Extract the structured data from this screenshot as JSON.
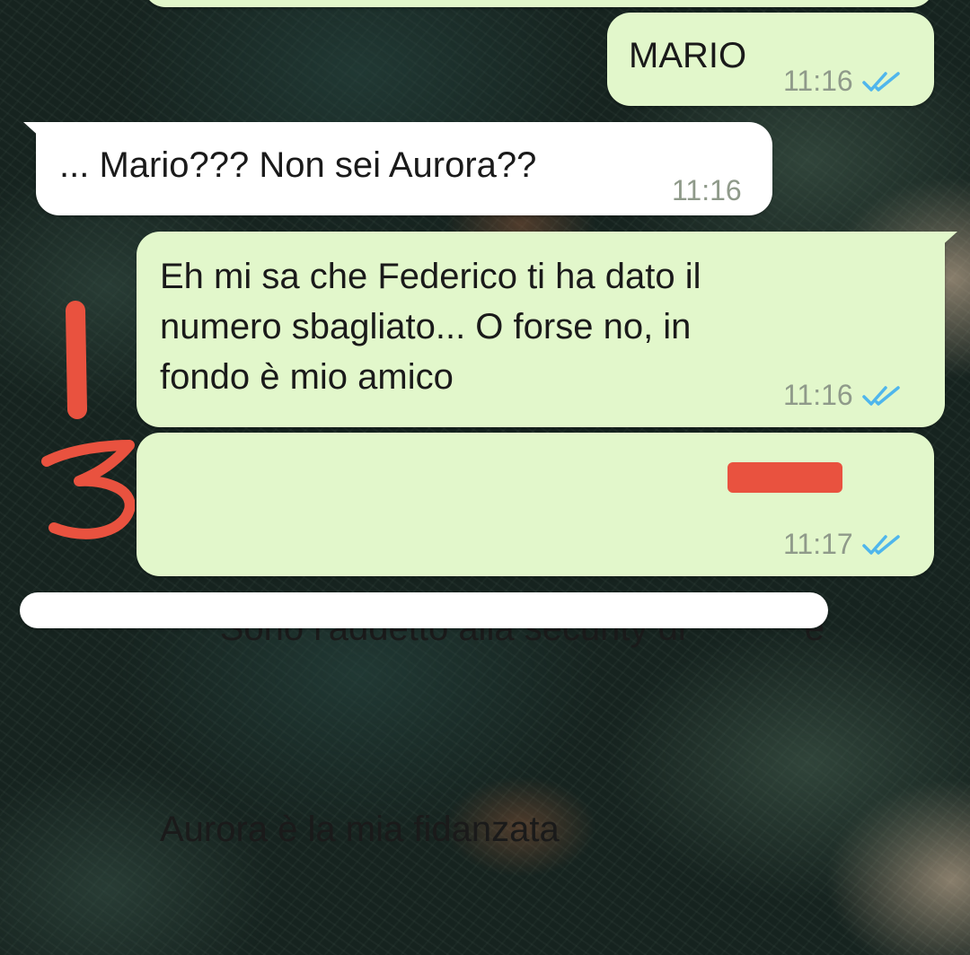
{
  "colors": {
    "outgoing_bubble": "#e2f7cb",
    "incoming_bubble": "#ffffff",
    "read_ticks": "#4fb6ec",
    "timestamp": "#8f9a8a",
    "annotation_red": "#e9523f"
  },
  "messages": [
    {
      "direction": "outgoing",
      "text": "MARIO",
      "time": "11:16",
      "status": "read",
      "status_icon": "double-check-icon"
    },
    {
      "direction": "incoming",
      "text": "... Mario??? Non sei Aurora??",
      "time": "11:16"
    },
    {
      "direction": "outgoing",
      "text": "Eh mi sa che Federico ti ha dato il\nnumero sbagliato... O forse no, in\nfondo è mio amico",
      "time": "11:16",
      "status": "read",
      "status_icon": "double-check-icon"
    },
    {
      "direction": "outgoing",
      "text_before_redaction": "Sono l'addetto alla security di",
      "text_after_redaction": "e",
      "text_line2": "Aurora è la mia fidanzata",
      "time": "11:17",
      "status": "read",
      "status_icon": "double-check-icon"
    }
  ],
  "annotation": {
    "handwritten_digits": "13"
  }
}
